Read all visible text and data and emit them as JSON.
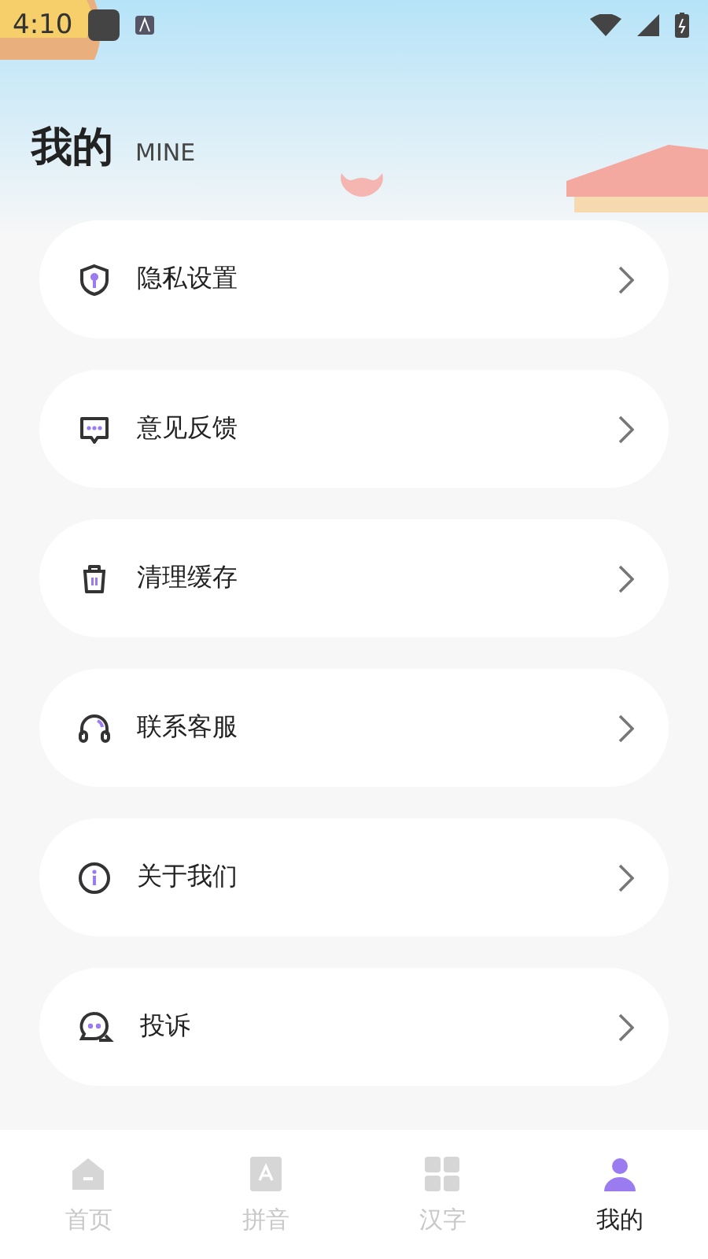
{
  "status_bar": {
    "time": "4:10"
  },
  "header": {
    "title": "我的",
    "subtitle": "MINE"
  },
  "menu": [
    {
      "label": "隐私设置"
    },
    {
      "label": "意见反馈"
    },
    {
      "label": "清理缓存"
    },
    {
      "label": "联系客服"
    },
    {
      "label": "关于我们"
    },
    {
      "label": "投诉"
    }
  ],
  "tabs": [
    {
      "label": "首页",
      "selected": false
    },
    {
      "label": "拼音",
      "selected": false
    },
    {
      "label": "汉字",
      "selected": false
    },
    {
      "label": "我的",
      "selected": true
    }
  ]
}
